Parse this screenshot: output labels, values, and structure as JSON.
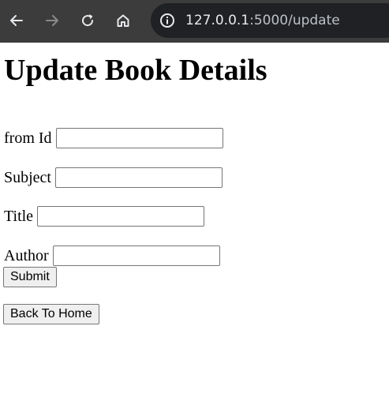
{
  "browser": {
    "url_host": "127.0.0.1",
    "url_rest": ":5000/update",
    "icons": [
      "back-arrow-icon",
      "forward-arrow-icon",
      "reload-icon",
      "home-icon",
      "site-info-icon"
    ]
  },
  "page": {
    "heading": "Update Book Details",
    "form": {
      "fields": [
        {
          "label": "from Id",
          "value": ""
        },
        {
          "label": "Subject",
          "value": ""
        },
        {
          "label": "Title",
          "value": ""
        },
        {
          "label": "Author",
          "value": ""
        }
      ],
      "submit_label": "Submit"
    },
    "back_home_label": "Back To Home"
  }
}
